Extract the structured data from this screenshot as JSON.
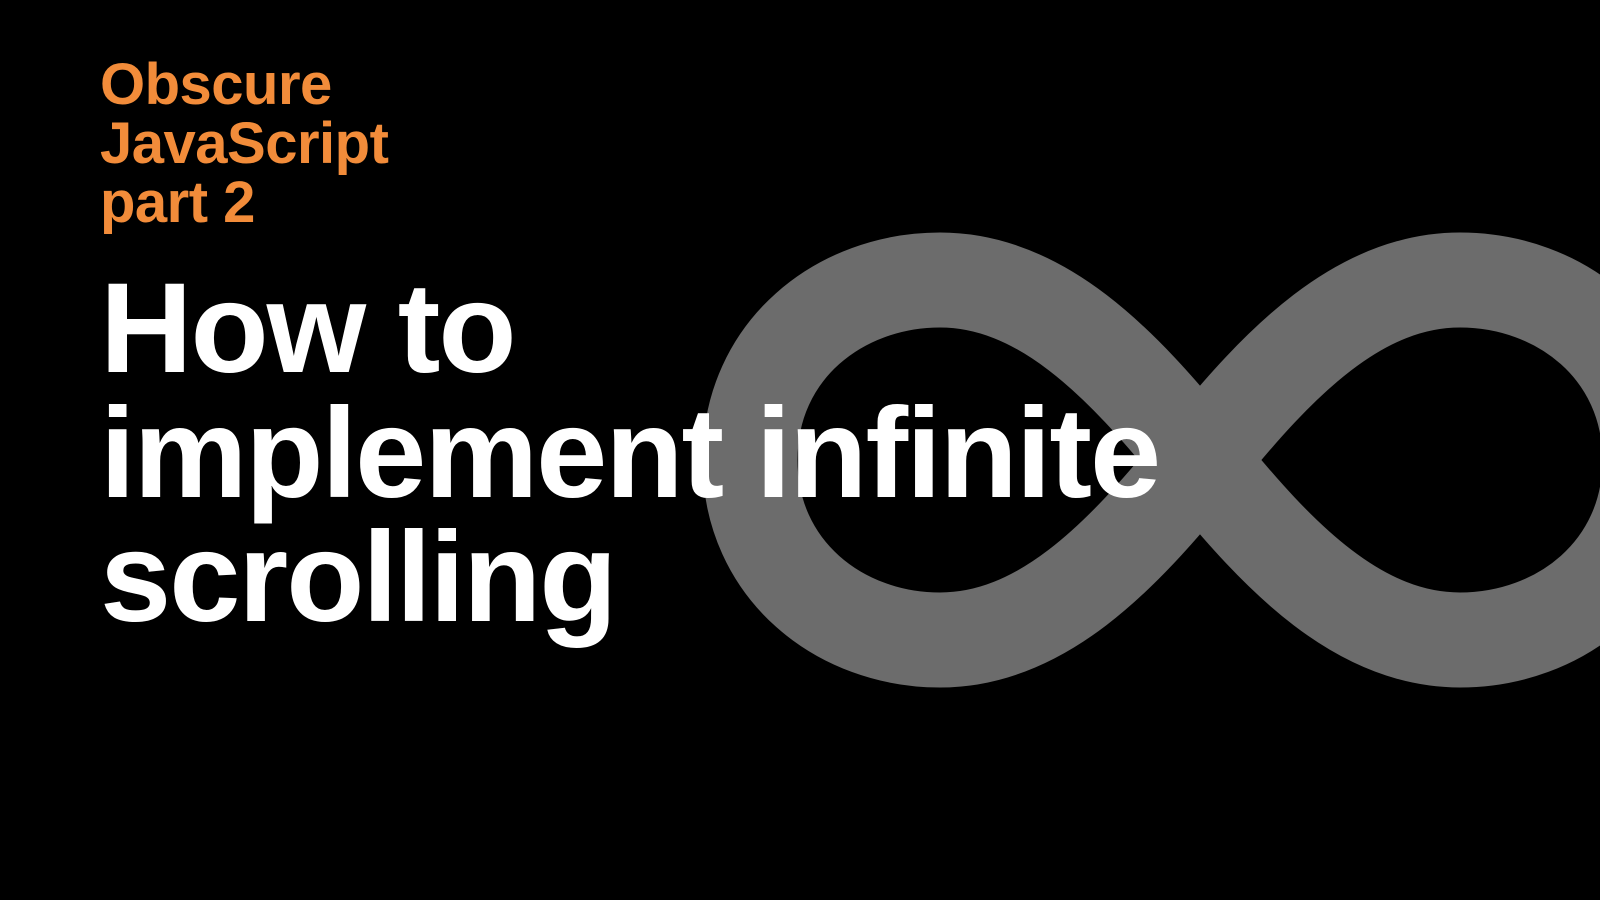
{
  "series": {
    "line1": "Obscure",
    "line2": "JavaScript",
    "line3": "part 2"
  },
  "title": {
    "line1": "How to",
    "line2": "implement infinite",
    "line3": "scrolling"
  },
  "colors": {
    "accent": "#f28c3a",
    "foreground": "#ffffff",
    "background": "#000000",
    "icon": "#6c6c6c"
  }
}
